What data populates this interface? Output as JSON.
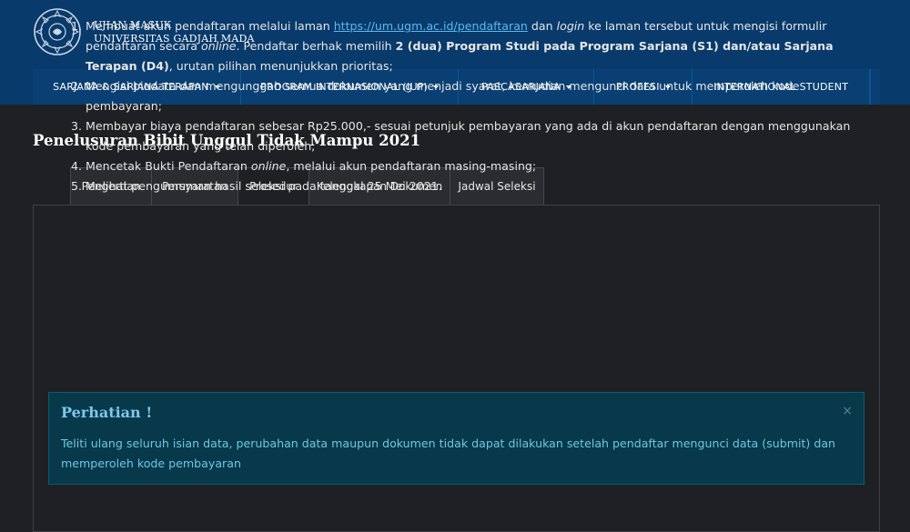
{
  "header": {
    "brand_line1": "UJIAN MASUK",
    "brand_line2": "UNIVERSITAS GADJAH MADA",
    "logo_icon": "ugm-seal-icon",
    "nav": [
      {
        "label": "SARJANA & SARJANA TERAPAN",
        "dropdown": true
      },
      {
        "label": "PROGRAM INTERNASIONAL (IUP)",
        "dropdown": true
      },
      {
        "label": "PASCASARJANA",
        "dropdown": true
      },
      {
        "label": "PROFESI",
        "dropdown": true
      },
      {
        "label": "INTERNATIONAL STUDENT",
        "dropdown": false
      }
    ]
  },
  "page": {
    "title": "Penelusuran Bibit Unggul Tidak Mampu 2021",
    "tabs": [
      {
        "label": "Pengertian"
      },
      {
        "label": "Persyaratan"
      },
      {
        "label": "Prosedur",
        "active": true
      },
      {
        "label": "Kelengkapan Dokumen"
      },
      {
        "label": "Jadwal Seleksi"
      }
    ]
  },
  "steps": {
    "s1_a": "Membuat akun pendaftaran melalui laman ",
    "s1_link": "https://um.ugm.ac.id/pendaftaran",
    "s1_b": " dan ",
    "s1_login": "login",
    "s1_c": " ke laman tersebut untuk mengisi formulir pendaftaran secara ",
    "s1_online": "online",
    "s1_d": ". Pendaftar berhak memilih ",
    "s1_bold": "2 (dua) Program Studi pada Program Sarjana (S1) dan/atau Sarjana Terapan (D4)",
    "s1_e": ", urutan pilihan menunjukkan prioritas;",
    "s2": "Mengisi biodata dan mengunggah semua dokumen yang menjadi syarat, kemudian mengunci data untuk memperoleh kode pembayaran;",
    "s3": "Membayar biaya pendaftaran sebesar Rp25.000,- sesuai petunjuk pembayaran yang ada di akun pendaftaran dengan menggunakan kode pembayaran yang telah diperoleh;",
    "s4_a": "Mencetak Bukti Pendaftaran ",
    "s4_online": "online",
    "s4_b": ", melalui akun pendaftaran masing-masing;",
    "s5": "Melihat pengumuman hasil seleksi pada tanggal 25 Mei 2021."
  },
  "alert": {
    "title": "Perhatian !",
    "close": "×",
    "text": "Teliti ulang seluruh isian data, perubahan data maupun dokumen tidak dapat dilakukan setelah pendaftar mengunci data (submit) dan memperoleh kode pembayaran"
  },
  "colors": {
    "header_bg": "#083a6b",
    "page_bg": "#1f2023",
    "link": "#5fb8f0",
    "alert_bg": "#07394a",
    "alert_text": "#6fc6e4"
  }
}
